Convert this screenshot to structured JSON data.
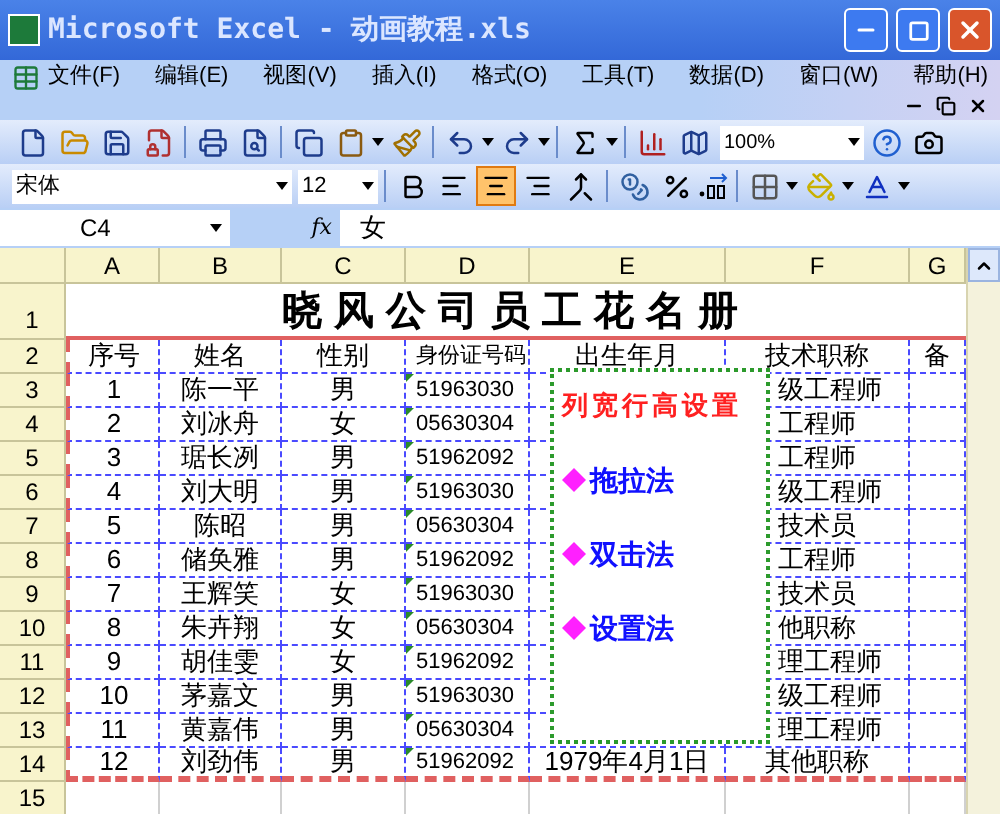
{
  "window": {
    "title": "Microsoft Excel - 动画教程.xls"
  },
  "menu": [
    "文件(F)",
    "编辑(E)",
    "视图(V)",
    "插入(I)",
    "格式(O)",
    "工具(T)",
    "数据(D)",
    "窗口(W)",
    "帮助(H)"
  ],
  "standard_toolbar": {
    "zoom": "100%"
  },
  "formatting_toolbar": {
    "font": "宋体",
    "size": "12",
    "alignment": [
      {
        "selected": false
      },
      {
        "selected": true
      },
      {
        "selected": false
      }
    ]
  },
  "formula_bar": {
    "cell": "C4",
    "function_label": "fx",
    "content": "女"
  },
  "sheet": {
    "columns": [
      "A",
      "B",
      "C",
      "D",
      "E",
      "F",
      "G"
    ],
    "title_row": {
      "number": "1",
      "title": "晓风公司员工花名册"
    },
    "rows": [
      {
        "number": "2",
        "cells": {
          "A": "序号",
          "B": "姓名",
          "C": "性别",
          "D": "身份证号码",
          "E": "出生年月",
          "F": "技术职称",
          "G": "备"
        }
      },
      {
        "number": "3",
        "cells": {
          "A": "1",
          "B": "陈一平",
          "C": "男",
          "D": "51963030",
          "F": "级工程师"
        }
      },
      {
        "number": "4",
        "cells": {
          "A": "2",
          "B": "刘冰舟",
          "C": "女",
          "D": "05630304",
          "F": "工程师"
        }
      },
      {
        "number": "5",
        "cells": {
          "A": "3",
          "B": "琚长冽",
          "C": "男",
          "D": "51962092",
          "F": "工程师"
        }
      },
      {
        "number": "6",
        "cells": {
          "A": "4",
          "B": "刘大明",
          "C": "男",
          "D": "51963030",
          "F": "级工程师"
        }
      },
      {
        "number": "7",
        "cells": {
          "A": "5",
          "B": "陈昭",
          "C": "男",
          "D": "05630304",
          "F": "技术员"
        }
      },
      {
        "number": "8",
        "cells": {
          "A": "6",
          "B": "储奂雅",
          "C": "男",
          "D": "51962092",
          "F": "工程师"
        }
      },
      {
        "number": "9",
        "cells": {
          "A": "7",
          "B": "王辉笑",
          "C": "女",
          "D": "51963030",
          "F": "技术员"
        }
      },
      {
        "number": "10",
        "cells": {
          "A": "8",
          "B": "朱卉翔",
          "C": "女",
          "D": "05630304",
          "F": "他职称"
        }
      },
      {
        "number": "11",
        "cells": {
          "A": "9",
          "B": "胡佳雯",
          "C": "女",
          "D": "51962092",
          "F": "理工程师"
        }
      },
      {
        "number": "12",
        "cells": {
          "A": "10",
          "B": "茅嘉文",
          "C": "男",
          "D": "51963030",
          "F": "级工程师"
        }
      },
      {
        "number": "13",
        "cells": {
          "A": "11",
          "B": "黄嘉伟",
          "C": "男",
          "D": "05630304",
          "F": "理工程师"
        }
      },
      {
        "number": "14",
        "cells": {
          "A": "12",
          "B": "刘劲伟",
          "C": "男",
          "D": "51962092",
          "E": "1979年4月1日",
          "F": "其他职称"
        }
      },
      {
        "number": "15"
      }
    ]
  },
  "note_box": {
    "title": "列宽行高设置",
    "items": [
      "拖拉法",
      "双击法",
      "设置法"
    ]
  }
}
